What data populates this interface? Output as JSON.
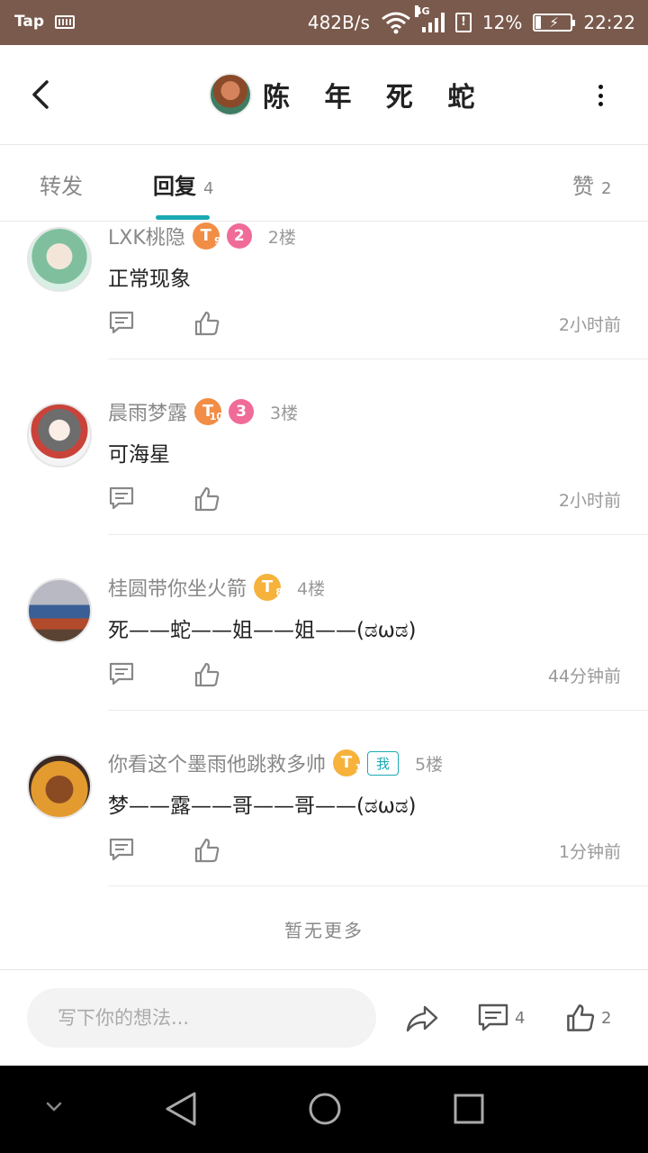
{
  "status_bar": {
    "app_label": "Tap",
    "net_speed": "482B/s",
    "network_type": "4G",
    "battery": "12%",
    "time": "22:22"
  },
  "header": {
    "title": "陈 年 死 蛇",
    "back_icon": "chevron-left-icon",
    "more_icon": "more-vertical-icon"
  },
  "tabs": [
    {
      "label": "转发",
      "count": ""
    },
    {
      "label": "回复",
      "count": "4"
    },
    {
      "label": "赞",
      "count": "2"
    }
  ],
  "active_tab_color": "#1aa9b4",
  "replies": [
    {
      "user": "LXK桃隐",
      "level": "T",
      "level_sub": "9",
      "rank": "2",
      "floor": "2楼",
      "content": "正常现象",
      "time": "2小时前"
    },
    {
      "user": "晨雨梦露",
      "level": "T",
      "level_sub": "10",
      "rank": "3",
      "floor": "3楼",
      "content": "可海星",
      "time": "2小时前"
    },
    {
      "user": "桂圆带你坐火箭",
      "level": "T",
      "level_sub": "8",
      "floor": "4楼",
      "content": "死——蛇——姐——姐——(ಡωಡ)",
      "time": "44分钟前"
    },
    {
      "user": "你看这个墨雨他跳救多帅",
      "level": "T",
      "level_sub": "1",
      "me_tag": "我",
      "floor": "5楼",
      "content": "梦——露——哥——哥——(ಡωಡ)",
      "time": "1分钟前"
    }
  ],
  "no_more": "暂无更多",
  "input_bar": {
    "placeholder": "写下你的想法...",
    "comment_count": "4",
    "like_count": "2"
  }
}
